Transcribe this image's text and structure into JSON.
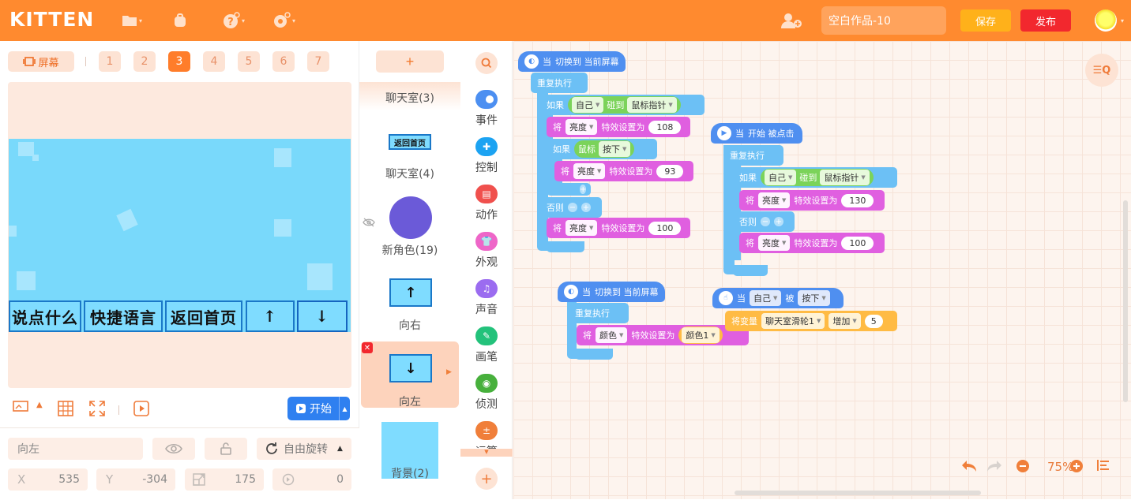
{
  "header": {
    "logo": "KITTEN",
    "project_title": "空白作品-10",
    "save_label": "保存",
    "publish_label": "发布",
    "icons": [
      "folder-icon",
      "backpack-icon",
      "help-icon",
      "settings-icon",
      "add-friend-icon"
    ]
  },
  "stage": {
    "screen_label": "屏幕",
    "pages": [
      "1",
      "2",
      "3",
      "4",
      "5",
      "6",
      "7"
    ],
    "active_page": "3",
    "canvas_buttons": [
      "说点什么",
      "快捷语言",
      "返回首页",
      "↑",
      "↓"
    ],
    "start_label": "开始"
  },
  "properties": {
    "sprite_name": "向左",
    "rotation_label": "自由旋转",
    "x_label": "X",
    "x_value": "535",
    "y_label": "Y",
    "y_value": "-304",
    "size_value": "175",
    "direction_value": "0"
  },
  "sprites": {
    "add_label": "+",
    "items": [
      {
        "name": "聊天室(3)"
      },
      {
        "name": "聊天室(4)",
        "thumb_text": "返回首页"
      },
      {
        "name": "新角色(19)"
      },
      {
        "name": "向右",
        "thumb_text": "↑"
      },
      {
        "name": "向左",
        "thumb_text": "↓"
      },
      {
        "name": "背景(2)"
      }
    ]
  },
  "categories": [
    {
      "name": "事件",
      "color": "#4c8ff1"
    },
    {
      "name": "控制",
      "color": "#1ca3f2"
    },
    {
      "name": "动作",
      "color": "#f0504d"
    },
    {
      "name": "外观",
      "color": "#ee66c8"
    },
    {
      "name": "声音",
      "color": "#9b6cf0"
    },
    {
      "name": "画笔",
      "color": "#23c27b"
    },
    {
      "name": "侦测",
      "color": "#47b03c"
    },
    {
      "name": "运算",
      "color": "#f07f3a"
    }
  ],
  "blocks": {
    "s1": {
      "hat_when": "当",
      "hat_text": "切换到 当前屏幕",
      "repeat": "重复执行",
      "if": "如果",
      "self": "自己",
      "touch": "碰到",
      "mouse_ptr": "鼠标指针",
      "set_a": "将",
      "bright": "亮度",
      "effect_set": "特效设置为",
      "v108": "108",
      "mouse": "鼠标",
      "pressed": "按下",
      "v93": "93",
      "else": "否则",
      "v100": "100"
    },
    "s2": {
      "hat_when": "当",
      "hat_text": "开始 被点击",
      "repeat": "重复执行",
      "if": "如果",
      "self": "自己",
      "touch": "碰到",
      "mouse_ptr": "鼠标指针",
      "set_a": "将",
      "bright": "亮度",
      "effect_set": "特效设置为",
      "v130": "130",
      "else": "否则",
      "v100": "100"
    },
    "s3": {
      "hat_when": "当",
      "hat_text": "切换到 当前屏幕",
      "repeat": "重复执行",
      "set_a": "将",
      "color": "颜色",
      "effect_set": "特效设置为",
      "color_val": "颜色1"
    },
    "s4": {
      "hat_when": "当",
      "self": "自己",
      "by": "被",
      "pressed": "按下",
      "var_label": "将变量",
      "var_name": "聊天室滑轮1",
      "increase": "增加",
      "amount": "5"
    }
  },
  "workspace": {
    "zoom": "75%"
  }
}
